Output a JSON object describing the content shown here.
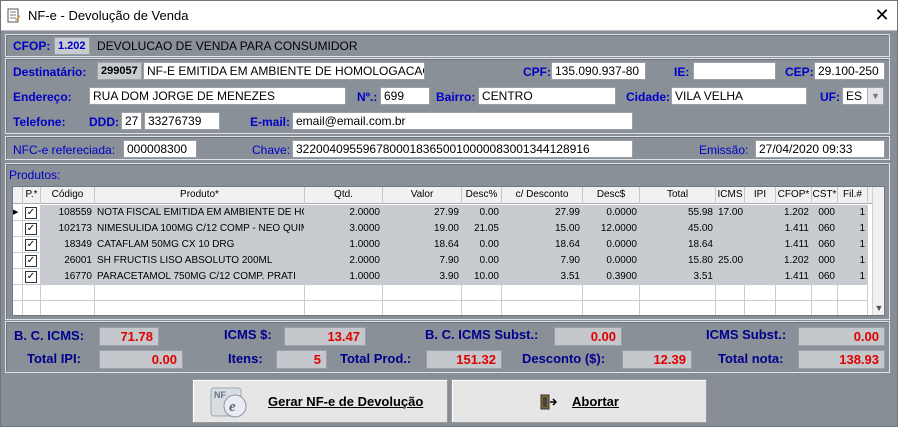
{
  "window": {
    "title": "NF-e - Devolução de Venda"
  },
  "cfop": {
    "label": "CFOP:",
    "code": "1.202",
    "description": "DEVOLUCAO DE VENDA PARA CONSUMIDOR"
  },
  "destinatario": {
    "label": "Destinatário:",
    "code": "299057",
    "name": "NF-E EMITIDA EM AMBIENTE DE HOMOLOGACAO",
    "cpf_label": "CPF:",
    "cpf": "135.090.937-80",
    "ie_label": "IE:",
    "ie": "",
    "cep_label": "CEP:",
    "cep": "29.100-250"
  },
  "endereco": {
    "label": "Endereço:",
    "value": "RUA DOM JORGE DE MENEZES",
    "numero_label": "Nº.:",
    "numero": "699",
    "bairro_label": "Bairro:",
    "bairro": "CENTRO",
    "cidade_label": "Cidade:",
    "cidade": "VILA VELHA",
    "uf_label": "UF:",
    "uf": "ES"
  },
  "telefone": {
    "label": "Telefone:",
    "ddd_label": "DDD:",
    "ddd": "27",
    "numero": "33276739",
    "email_label": "E-mail:",
    "email": "email@email.com.br"
  },
  "referencia": {
    "nfe_label": "NFC-e refereciada:",
    "nfe": "000008300",
    "chave_label": "Chave:",
    "chave": "32200409559678000183650010000083001344128916",
    "emissao_label": "Emissão:",
    "emissao": "27/04/2020 09:33"
  },
  "produtos": {
    "label": "Produtos:",
    "columns": [
      "P.*",
      "Código",
      "Produto*",
      "Qtd.",
      "Valor",
      "Desc%",
      "c/ Desconto",
      "Desc$",
      "Total",
      "ICMS",
      "IPI",
      "CFOP*",
      "CST*",
      "Fil.#"
    ],
    "rows": [
      {
        "checked": true,
        "codigo": "108559",
        "produto": "NOTA FISCAL EMITIDA EM AMBIENTE DE HO",
        "qtd": "2.0000",
        "valor": "27.99",
        "desc_pct": "0.00",
        "c_desconto": "27.99",
        "desc_val": "0.0000",
        "total": "55.98",
        "icms": "17.00",
        "ipi": "",
        "cfop": "1.202",
        "cst": "000",
        "fil": "1"
      },
      {
        "checked": true,
        "codigo": "102173",
        "produto": "NIMESULIDA 100MG C/12 COMP - NEO QUIM",
        "qtd": "3.0000",
        "valor": "19.00",
        "desc_pct": "21.05",
        "c_desconto": "15.00",
        "desc_val": "12.0000",
        "total": "45.00",
        "icms": "",
        "ipi": "",
        "cfop": "1.411",
        "cst": "060",
        "fil": "1"
      },
      {
        "checked": true,
        "codigo": "18349",
        "produto": "CATAFLAM 50MG CX 10 DRG",
        "qtd": "1.0000",
        "valor": "18.64",
        "desc_pct": "0.00",
        "c_desconto": "18.64",
        "desc_val": "0.0000",
        "total": "18.64",
        "icms": "",
        "ipi": "",
        "cfop": "1.411",
        "cst": "060",
        "fil": "1"
      },
      {
        "checked": true,
        "codigo": "26001",
        "produto": "SH FRUCTIS LISO ABSOLUTO 200ML",
        "qtd": "2.0000",
        "valor": "7.90",
        "desc_pct": "0.00",
        "c_desconto": "7.90",
        "desc_val": "0.0000",
        "total": "15.80",
        "icms": "25.00",
        "ipi": "",
        "cfop": "1.202",
        "cst": "000",
        "fil": "1"
      },
      {
        "checked": true,
        "codigo": "16770",
        "produto": "PARACETAMOL 750MG C/12 COMP. PRATI",
        "qtd": "1.0000",
        "valor": "3.90",
        "desc_pct": "10.00",
        "c_desconto": "3.51",
        "desc_val": "0.3900",
        "total": "3.51",
        "icms": "",
        "ipi": "",
        "cfop": "1.411",
        "cst": "060",
        "fil": "1"
      }
    ]
  },
  "totais": {
    "bc_icms_label": "B. C. ICMS:",
    "bc_icms": "71.78",
    "icms_label": "ICMS $:",
    "icms": "13.47",
    "bc_icms_st_label": "B. C. ICMS Subst.:",
    "bc_icms_st": "0.00",
    "icms_st_label": "ICMS Subst.:",
    "icms_st": "0.00",
    "ipi_label": "Total IPI:",
    "ipi": "0.00",
    "itens_label": "Itens:",
    "itens": "5",
    "prod_label": "Total Prod.:",
    "prod": "151.32",
    "desconto_label": "Desconto ($):",
    "desconto": "12.39",
    "nota_label": "Total nota:",
    "nota": "138.93"
  },
  "buttons": {
    "gerar": "Gerar NF-e de Devolução",
    "abortar": "Abortar"
  },
  "colors": {
    "label_blue": "#0000c8",
    "value_red": "#e00000",
    "panel": "#8a9098"
  }
}
